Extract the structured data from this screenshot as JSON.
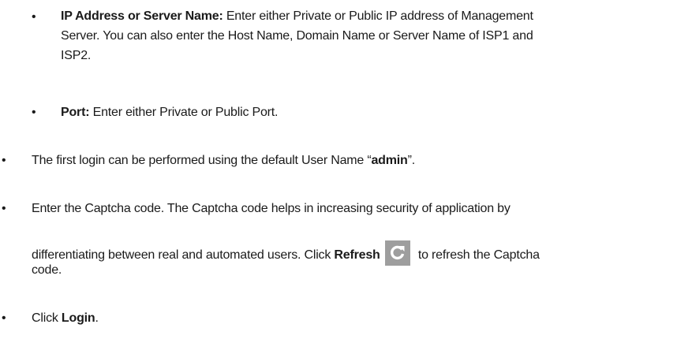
{
  "sub_items": [
    {
      "label": "IP Address or Server Name:",
      "text_line1": "Enter either Private or Public IP address of Management",
      "text_line2": "Server. You can also enter the Host Name, Domain Name or Server Name of ISP1 and",
      "text_line3": "ISP2."
    },
    {
      "label": "Port:",
      "text": "Enter either Private or Public Port."
    }
  ],
  "items": [
    {
      "text_before": "The first login can be performed using the default User Name “",
      "bold": "admin",
      "text_after": "”."
    },
    {
      "line1": "Enter the Captcha code. The Captcha code helps in increasing security of application by",
      "line2_before": "differentiating between real and automated users. Click",
      "line2_bold": "Refresh",
      "line2_after": "to refresh the Captcha",
      "line3": "code.",
      "icon": "refresh-icon"
    },
    {
      "text_before": "Click",
      "bold": "Login",
      "text_after": "."
    }
  ],
  "bullet_char": "•",
  "colors": {
    "text": "#1a1a1a",
    "icon_bg": "#9e9e9e",
    "icon_fg": "#ffffff"
  }
}
